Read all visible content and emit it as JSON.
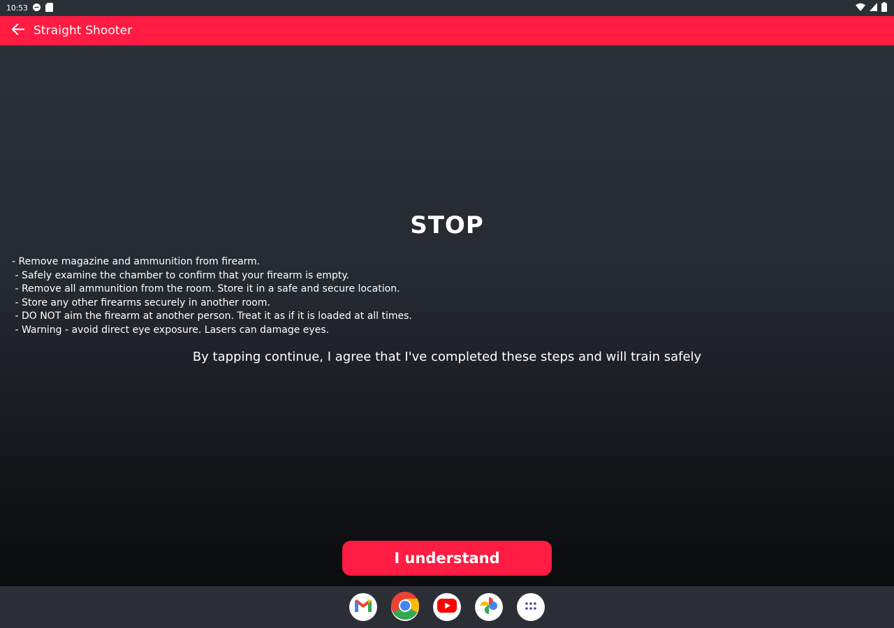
{
  "status_bar": {
    "time": "10:53"
  },
  "app_bar": {
    "title": "Straight Shooter"
  },
  "main": {
    "heading": "STOP",
    "steps": [
      "- Remove magazine and ammunition from firearm.",
      " - Safely examine the chamber to confirm that your firearm is empty.",
      " - Remove all ammunition from the room. Store it in a safe and secure location.",
      " - Store any other firearms securely in another room.",
      " - DO NOT aim the firearm at another person. Treat it as if it is loaded at all times.",
      " - Warning - avoid direct eye exposure. Lasers can damage eyes."
    ],
    "agreement": "By tapping continue, I agree that I've completed these steps and will train safely",
    "button_label": "I understand"
  },
  "colors": {
    "accent": "#ff1c42",
    "status_bar_bg": "#2b2f36",
    "dock_bg": "#2b2e34"
  },
  "dock": {
    "apps": [
      "gmail-icon",
      "chrome-icon",
      "youtube-icon",
      "photos-icon",
      "app-drawer-icon"
    ]
  }
}
